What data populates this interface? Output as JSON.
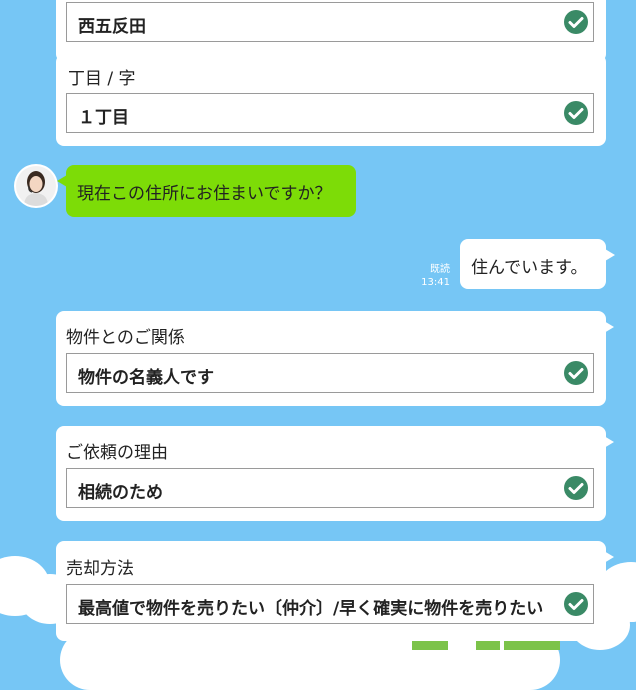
{
  "cards": [
    {
      "id": "town",
      "label": "",
      "value": "西五反田"
    },
    {
      "id": "chome",
      "label": "丁目 / 字",
      "value": "１丁目"
    },
    {
      "id": "relation",
      "label": "物件とのご関係",
      "value": "物件の名義人です"
    },
    {
      "id": "reason",
      "label": "ご依頼の理由",
      "value": "相続のため"
    },
    {
      "id": "method",
      "label": "売却方法",
      "value": "最高値で物件を売りたい〔仲介〕/早く確実に物件を売りたい"
    }
  ],
  "chat": {
    "operator_message": "現在この住所にお住まいですか？",
    "user_reply": "住んでいます。",
    "read_status": "既読",
    "time": "13:41"
  },
  "colors": {
    "background": "#76c6f5",
    "operator_bubble": "#7ddc07",
    "check": "#3a8a66"
  },
  "icons": {
    "check": "check-circle-icon",
    "avatar": "operator-avatar"
  }
}
